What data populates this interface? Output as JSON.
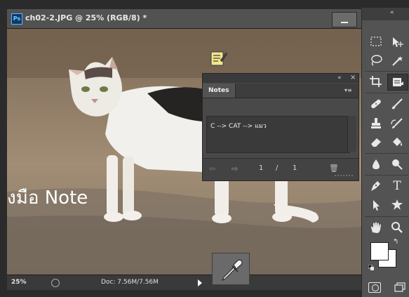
{
  "document": {
    "ps_logo": "Ps",
    "title": "ch02-2.JPG @ 25% (RGB/8) *",
    "zoom": "25%",
    "doc_size": "Doc: 7.56M/7.56M",
    "overlay_text": "งมือ Note"
  },
  "notes_panel": {
    "collapse": "«",
    "close": "×",
    "tab_label": "Notes",
    "menu_icon": "▾≡",
    "note_text": "C --> CAT --> แมว",
    "current_note": "1",
    "separator": "/",
    "total_notes": "1",
    "prev_arrow": "⇦",
    "next_arrow": "⇨",
    "delete_icon": "🗑"
  },
  "toolbar": {
    "collapse": "«",
    "swap_icon": "↰"
  },
  "colors": {
    "foreground": "#ffffff",
    "background": "#ffffff",
    "accent": "#0a3a69"
  },
  "icons": [
    "marquee-icon",
    "move-icon",
    "lasso-icon",
    "magic-wand-icon",
    "crop-icon",
    "note-tool-icon",
    "healing-brush-icon",
    "brush-icon",
    "clone-stamp-icon",
    "history-brush-icon",
    "eraser-icon",
    "paint-bucket-icon",
    "blur-icon",
    "dodge-icon",
    "pen-icon",
    "type-icon",
    "path-selection-icon",
    "shape-icon",
    "hand-icon",
    "zoom-icon",
    "eyedropper-icon",
    "note-icon"
  ]
}
